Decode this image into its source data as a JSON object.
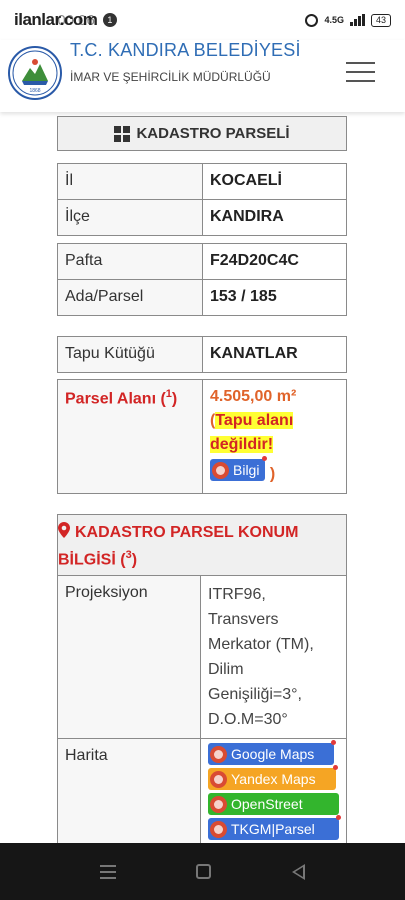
{
  "status_bar": {
    "watermark": "ilanlar.com",
    "time": "00:06",
    "notif_count": "1",
    "network": "4.5G",
    "battery": "43"
  },
  "header": {
    "org_title": "T.C. KANDIRA BELEDİYESİ",
    "org_subtitle": "İMAR VE ŞEHİRCİLİK MÜDÜRLÜĞÜ",
    "logo_text_top": "KANDIRA BELEDİYESİ",
    "logo_year": "1868"
  },
  "kadastro": {
    "title": "KADASTRO PARSELİ",
    "il_label": "İl",
    "il_value": "KOCAELİ",
    "ilce_label": "İlçe",
    "ilce_value": "KANDIRA",
    "pafta_label": "Pafta",
    "pafta_value": "F24D20C4C",
    "ada_label": "Ada/Parsel",
    "ada_value": "153 / 185",
    "tapu_label": "Tapu Kütüğü",
    "tapu_value": "KANATLAR",
    "alan_label": "Parsel Alanı (",
    "alan_ref": "1",
    "alan_label_end": ")",
    "alan_value": "4.505,00 m²",
    "alan_note_open": "(",
    "alan_note": "Tapu alanı değildir!",
    "bilgi_label": "Bilgi",
    "alan_note_close": ")"
  },
  "konum": {
    "title": "KADASTRO PARSEL KONUM BİLGİSİ (",
    "ref": "3",
    "title_end": ")",
    "projeksiyon_label": "Projeksiyon",
    "projeksiyon_value": "ITRF96, Transvers Merkator (TM), Dilim Genişiliği=3°, D.O.M=30°",
    "harita_label": "Harita",
    "maps": [
      {
        "label": "Google Maps",
        "color": "#3b6fd6"
      },
      {
        "label": "Yandex Maps",
        "color": "#f5a524"
      },
      {
        "label": "OpenStreet",
        "color": "#33b52d"
      },
      {
        "label": "TKGM|Parsel",
        "color": "#3b6fd6"
      }
    ]
  },
  "colors": {
    "accent_blue": "#2f6db5",
    "alert_red": "#d22525",
    "area_orange": "#e0632a",
    "highlight": "#ffff33"
  }
}
